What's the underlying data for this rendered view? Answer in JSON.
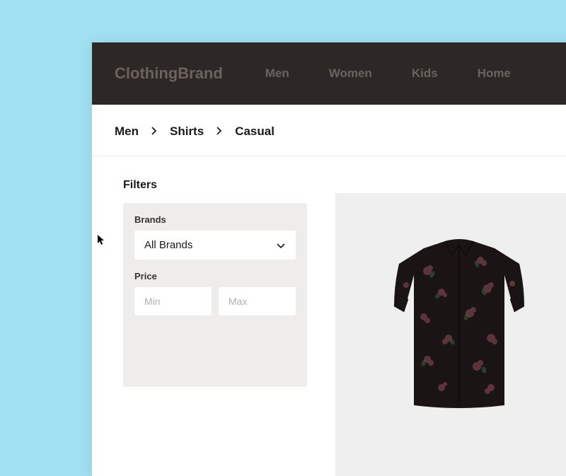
{
  "header": {
    "logo": "ClothingBrand",
    "nav": [
      {
        "label": "Men"
      },
      {
        "label": "Women"
      },
      {
        "label": "Kids"
      },
      {
        "label": "Home"
      }
    ]
  },
  "breadcrumb": [
    {
      "label": "Men"
    },
    {
      "label": "Shirts"
    },
    {
      "label": "Casual"
    }
  ],
  "filters": {
    "title": "Filters",
    "brands": {
      "label": "Brands",
      "selected": "All Brands"
    },
    "price": {
      "label": "Price",
      "min_placeholder": "Min",
      "max_placeholder": "Max"
    }
  }
}
